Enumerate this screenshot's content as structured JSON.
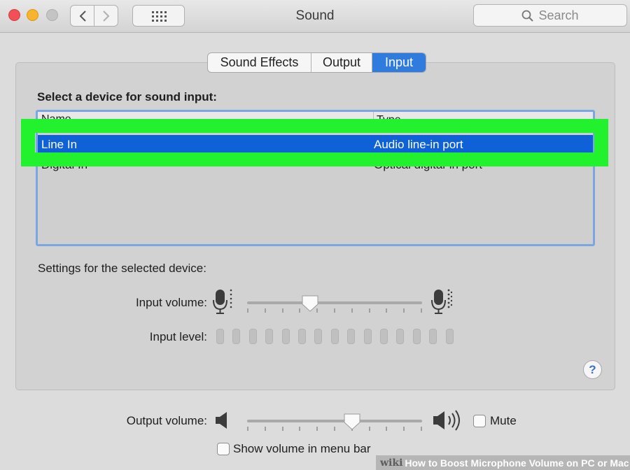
{
  "window": {
    "title": "Sound",
    "search_placeholder": "Search"
  },
  "tabs": [
    {
      "label": "Sound Effects",
      "selected": false
    },
    {
      "label": "Output",
      "selected": false
    },
    {
      "label": "Input",
      "selected": true
    }
  ],
  "input": {
    "device_heading": "Select a device for sound input:",
    "columns": [
      "Name",
      "Type"
    ],
    "devices": [
      {
        "name": "Line In",
        "type": "Audio line-in port",
        "selected": true
      },
      {
        "name": "Digital In",
        "type": "Optical digital-in port",
        "selected": false
      }
    ],
    "settings_heading": "Settings for the selected device:",
    "input_volume_label": "Input volume:",
    "input_volume_value": 0.36,
    "input_level_label": "Input level:",
    "input_level_active_bars": 0
  },
  "output": {
    "output_volume_label": "Output volume:",
    "output_volume_value": 0.6,
    "mute_label": "Mute",
    "mute_checked": false,
    "menu_bar_label": "Show volume in menu bar",
    "menu_bar_checked": false
  },
  "help_label": "?",
  "highlight_color": "#22f12d",
  "selection_color": "#0e61d6",
  "accent_color": "#2f7bde",
  "watermark": {
    "brand": "wiki",
    "text": "How to Boost Microphone Volume on PC or Mac"
  }
}
